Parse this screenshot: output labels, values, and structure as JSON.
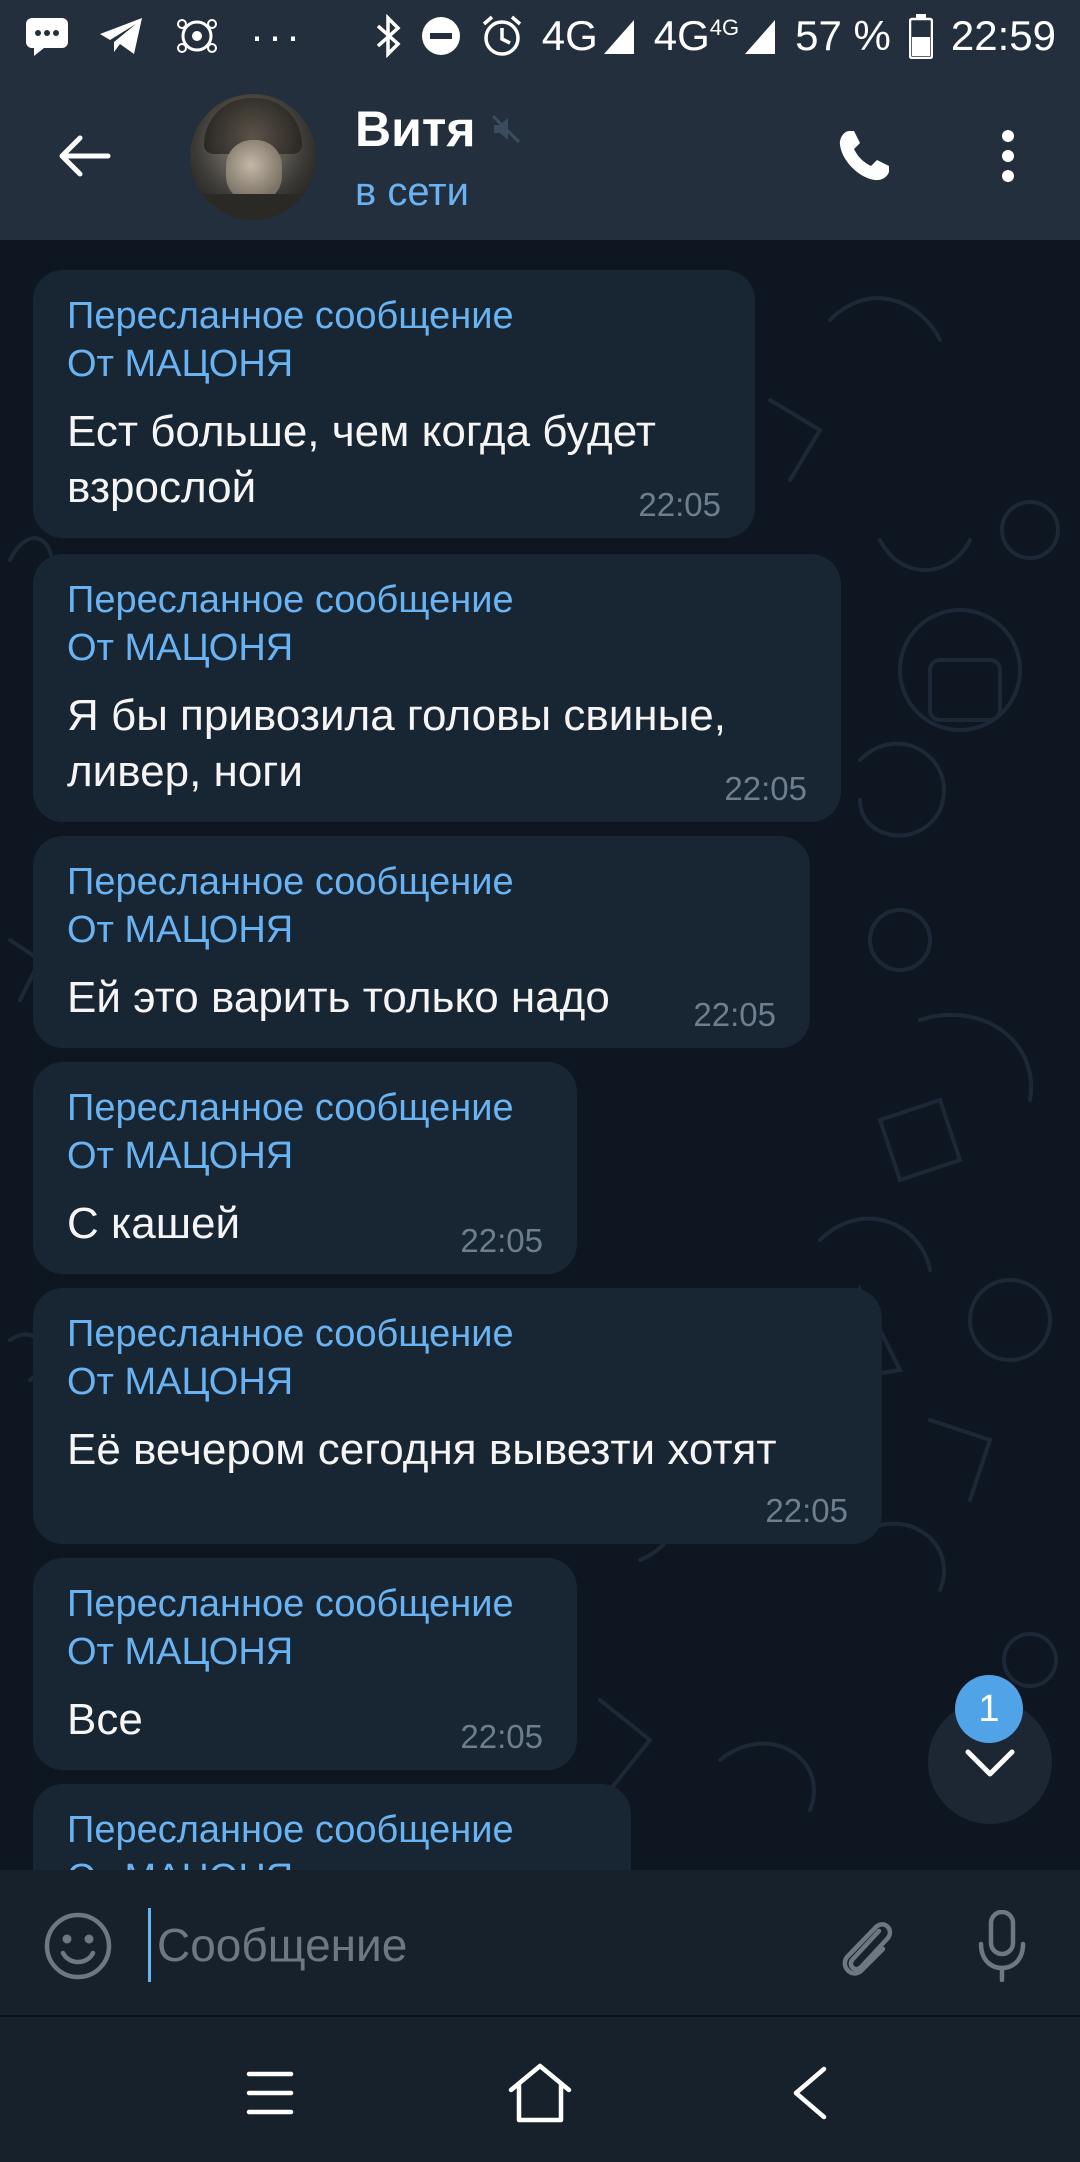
{
  "status_bar": {
    "network_1": "4G",
    "network_2": "4G",
    "network_2_sup": "4G",
    "battery": "57 %",
    "time": "22:59",
    "more": "···"
  },
  "header": {
    "contact_name": "Витя",
    "contact_status": "в сети"
  },
  "messages": [
    {
      "forward_label": "Пересланное сообщение",
      "from": "От МАЦОНЯ",
      "text": "Ест больше, чем когда будет взрослой",
      "time": "22:05"
    },
    {
      "forward_label": "Пересланное сообщение",
      "from": "От МАЦОНЯ",
      "text": "Я бы привозила головы свиные, ливер, ноги",
      "time": "22:05"
    },
    {
      "forward_label": "Пересланное сообщение",
      "from": "От МАЦОНЯ",
      "text": "Ей это варить только надо",
      "time": "22:05"
    },
    {
      "forward_label": "Пересланное сообщение",
      "from": "От МАЦОНЯ",
      "text": "С кашей",
      "time": "22:05"
    },
    {
      "forward_label": "Пересланное сообщение",
      "from": "От МАЦОНЯ",
      "text": "Её вечером сегодня вывезти хотят",
      "time": "22:05"
    },
    {
      "forward_label": "Пересланное сообщение",
      "from": "От МАЦОНЯ",
      "text": "Все",
      "time": "22:05"
    },
    {
      "forward_label": "Пересланное сообщение",
      "from": "От МАЦОНЯ",
      "text": "",
      "time": ""
    }
  ],
  "unread_count": "1",
  "composer": {
    "placeholder": "Сообщение"
  },
  "colors": {
    "accent": "#6ab3f3",
    "header_bg": "#242f3d",
    "chat_bg": "#0e1621",
    "bubble_bg": "#182533",
    "badge": "#4fa3e6"
  },
  "icons": [
    "back-arrow-icon",
    "muted-icon",
    "phone-icon",
    "more-vert-icon",
    "emoji-icon",
    "paperclip-icon",
    "mic-icon",
    "chevron-down-icon",
    "nav-menu-icon",
    "nav-home-icon",
    "nav-back-icon"
  ]
}
